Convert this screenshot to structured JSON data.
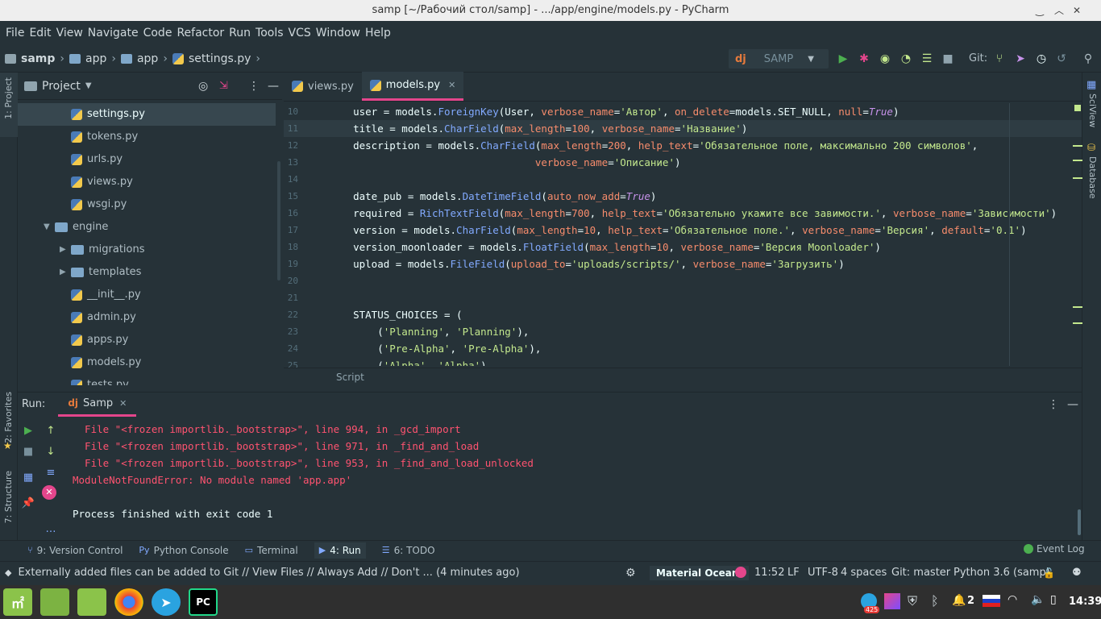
{
  "window": {
    "title": "samp [~/Рабочий стол/samp] - .../app/engine/models.py - PyCharm"
  },
  "menu": [
    "File",
    "Edit",
    "View",
    "Navigate",
    "Code",
    "Refactor",
    "Run",
    "Tools",
    "VCS",
    "Window",
    "Help"
  ],
  "breadcrumbs": [
    "samp",
    "app",
    "app",
    "settings.py"
  ],
  "run_config": {
    "label": "SAMP",
    "prefix": "dj"
  },
  "git_label": "Git:",
  "left_strip": {
    "project": "1: Project",
    "favorites": "2: Favorites",
    "structure": "7: Structure"
  },
  "right_strip": {
    "sciview": "SciView",
    "database": "Database"
  },
  "project_panel": {
    "title": "Project"
  },
  "tree": [
    {
      "label": "settings.py",
      "type": "py",
      "indent": 3,
      "selected": true
    },
    {
      "label": "tokens.py",
      "type": "py",
      "indent": 3
    },
    {
      "label": "urls.py",
      "type": "py",
      "indent": 3
    },
    {
      "label": "views.py",
      "type": "py",
      "indent": 3
    },
    {
      "label": "wsgi.py",
      "type": "py",
      "indent": 3
    },
    {
      "label": "engine",
      "type": "folder",
      "indent": 2,
      "expanded": true
    },
    {
      "label": "migrations",
      "type": "folder",
      "indent": 3
    },
    {
      "label": "templates",
      "type": "folder",
      "indent": 3
    },
    {
      "label": "__init__.py",
      "type": "py",
      "indent": 3
    },
    {
      "label": "admin.py",
      "type": "py",
      "indent": 3
    },
    {
      "label": "apps.py",
      "type": "py",
      "indent": 3
    },
    {
      "label": "models.py",
      "type": "py",
      "indent": 3
    },
    {
      "label": "tests.py",
      "type": "py",
      "indent": 3
    }
  ],
  "editor_tabs": [
    {
      "label": "views.py",
      "active": false
    },
    {
      "label": "models.py",
      "active": true
    }
  ],
  "code_lines": [
    {
      "n": "10",
      "html": "    user = models.<span class=\"f\">ForeignKey</span>(User, <span class=\"p\">verbose_name</span>=<span class=\"s\">'Автор'</span>, <span class=\"p\">on_delete</span>=models.SET_NULL, <span class=\"p\">null</span>=<span class=\"b\">True</span>)"
    },
    {
      "n": "11",
      "html": "    title = models.<span class=\"f\">CharField</span>(<span class=\"p\">max_length</span>=<span class=\"n\">100</span>, <span class=\"p\">verbose_name</span>=<span class=\"s\">'Название'</span>)",
      "hl": true
    },
    {
      "n": "12",
      "html": "    description = models.<span class=\"f\">CharField</span>(<span class=\"p\">max_length</span>=<span class=\"n\">200</span>, <span class=\"p\">help_text</span>=<span class=\"s\">'Обязательное поле, максимально 200 символов'</span>,"
    },
    {
      "n": "13",
      "html": "                                  <span class=\"p\">verbose_name</span>=<span class=\"s\">'Описание'</span>)"
    },
    {
      "n": "14",
      "html": ""
    },
    {
      "n": "15",
      "html": "    date_pub = models.<span class=\"f\">DateTimeField</span>(<span class=\"p\">auto_now_add</span>=<span class=\"b\">True</span>)"
    },
    {
      "n": "16",
      "html": "    required = <span class=\"f\">RichTextField</span>(<span class=\"p\">max_length</span>=<span class=\"n\">700</span>, <span class=\"p\">help_text</span>=<span class=\"s\">'Обязательно укажите все завимости.'</span>, <span class=\"p\">verbose_name</span>=<span class=\"s\">'Зависимости'</span>)"
    },
    {
      "n": "17",
      "html": "    version = models.<span class=\"f\">CharField</span>(<span class=\"p\">max_length</span>=<span class=\"n\">10</span>, <span class=\"p\">help_text</span>=<span class=\"s\">'Обязательное поле.'</span>, <span class=\"p\">verbose_name</span>=<span class=\"s\">'Версия'</span>, <span class=\"p\">default</span>=<span class=\"s\">'0.1'</span>)"
    },
    {
      "n": "18",
      "html": "    version_moonloader = models.<span class=\"f\">FloatField</span>(<span class=\"p\">max_length</span>=<span class=\"n\">10</span>, <span class=\"p\">verbose_name</span>=<span class=\"s\">'Версия Moonloader'</span>)"
    },
    {
      "n": "19",
      "html": "    upload = models.<span class=\"f\">FileField</span>(<span class=\"p\">upload_to</span>=<span class=\"s\">'uploads/scripts/'</span>, <span class=\"p\">verbose_name</span>=<span class=\"s\">'Загрузить'</span>)"
    },
    {
      "n": "20",
      "html": ""
    },
    {
      "n": "21",
      "html": ""
    },
    {
      "n": "22",
      "html": "    STATUS_CHOICES = ("
    },
    {
      "n": "23",
      "html": "        (<span class=\"s\">'Planning'</span>, <span class=\"s\">'Planning'</span>),"
    },
    {
      "n": "24",
      "html": "        (<span class=\"s\">'Pre-Alpha'</span>, <span class=\"s\">'Pre-Alpha'</span>),"
    },
    {
      "n": "25",
      "html": "        (<span class=\"s\">'Alpha'</span>, <span class=\"s\">'Alpha'</span>),"
    }
  ],
  "editor_breadcrumb": "Script",
  "run": {
    "label": "Run:",
    "config": "Samp"
  },
  "output": [
    {
      "text": "  File \"<frozen importlib._bootstrap>\", line 994, in _gcd_import",
      "cls": "err"
    },
    {
      "text": "  File \"<frozen importlib._bootstrap>\", line 971, in _find_and_load",
      "cls": "err"
    },
    {
      "text": "  File \"<frozen importlib._bootstrap>\", line 953, in _find_and_load_unlocked",
      "cls": "err"
    },
    {
      "text": "ModuleNotFoundError: No module named 'app.app'",
      "cls": "err"
    },
    {
      "text": "",
      "cls": "ok"
    },
    {
      "text": "Process finished with exit code 1",
      "cls": "ok"
    }
  ],
  "toolwindows": [
    {
      "label": "9: Version Control",
      "icon": "version-control-icon"
    },
    {
      "label": "Python Console",
      "icon": "python-console-icon"
    },
    {
      "label": "Terminal",
      "icon": "terminal-icon"
    },
    {
      "label": "4: Run",
      "icon": "run-icon",
      "active": true
    },
    {
      "label": "6: TODO",
      "icon": "todo-icon"
    }
  ],
  "event_log": "Event Log",
  "status": {
    "message": "Externally added files can be added to Git // View Files // Always Add // Don't ... (4 minutes ago)",
    "theme": "Material Oceani",
    "position": "11:52",
    "line_sep": "LF",
    "encoding": "UTF-8",
    "indent": "4 spaces",
    "git": "Git: master",
    "interpreter": "Python 3.6 (samp)"
  },
  "taskbar": {
    "clock": "14:39",
    "badge": "425",
    "notify_count": "2"
  },
  "colors": {
    "bg": "#263238",
    "accent": "#e4468c"
  }
}
